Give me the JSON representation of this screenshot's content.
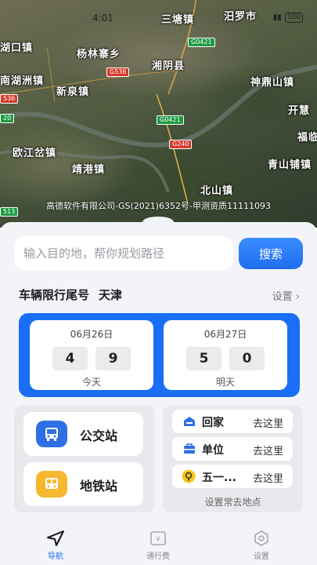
{
  "status_bar": {
    "time": "4:01",
    "battery": "100"
  },
  "map": {
    "labels": {
      "sanTang": "三塘镇",
      "miluo": "汨罗市",
      "hukou": "湖口镇",
      "yanglinzhai": "杨林寨乡",
      "xiangyin": "湘阴县",
      "nanhuzhou": "南湖洲镇",
      "shendingshan": "神鼎山镇",
      "xinquan": "新泉镇",
      "kaihui": "开慧",
      "fushou": "福临",
      "oujiangcha": "欧江岔镇",
      "jinggang": "靖港镇",
      "qingshanpu": "青山铺镇",
      "beishan": "北山镇"
    },
    "roads": {
      "g0421_top": "G0421",
      "g536": "G536",
      "g0421_mid": "G0421",
      "g240": "G240",
      "s536": "536",
      "s513": "513",
      "edge20": "20"
    },
    "copyright": "高德软件有限公司-GS(2021)6352号-甲测资质11111093"
  },
  "search": {
    "placeholder": "输入目的地，帮你规划路径",
    "button": "搜索"
  },
  "restriction": {
    "title": "车辆限行尾号",
    "city": "天津",
    "settings": "设置 ›",
    "days": [
      {
        "date": "06月26日",
        "digits": [
          "4",
          "9"
        ],
        "label": "今天"
      },
      {
        "date": "06月27日",
        "digits": [
          "5",
          "0"
        ],
        "label": "明天"
      }
    ]
  },
  "transit": {
    "bus": "公交站",
    "metro": "地铁站",
    "bus_color": "#2f6fe6",
    "metro_color": "#f5b82e"
  },
  "places": {
    "items": [
      {
        "name": "回家",
        "action": "去这里"
      },
      {
        "name": "单位",
        "action": "去这里"
      },
      {
        "name": "五一...",
        "action": "去这里"
      }
    ],
    "footer": "设置常去地点"
  },
  "tabs": {
    "nav": "导航",
    "toll": "通行费",
    "settings": "设置"
  },
  "colors": {
    "accent": "#1a6ef5"
  }
}
